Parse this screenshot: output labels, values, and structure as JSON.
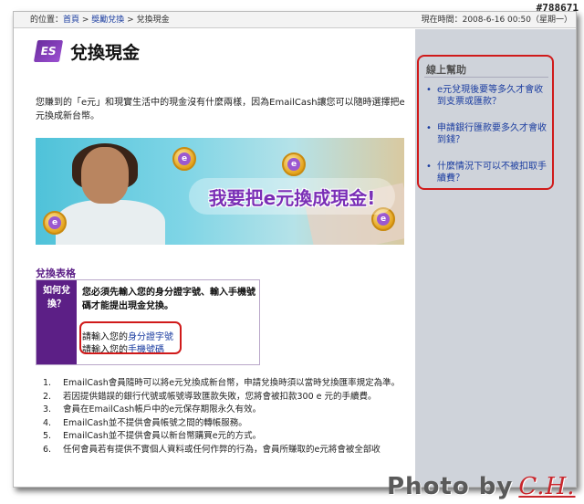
{
  "watermark": {
    "id_tag": "#788671"
  },
  "topbar": {
    "location_prefix": "的位置：",
    "crumb_home": "首頁",
    "crumb_sep1": " > ",
    "crumb_rewards": "獎勵兌換",
    "crumb_sep2": " > ",
    "crumb_current": "兌換現金",
    "datetime": "現在時間：2008-6-16 00:50（星期一）"
  },
  "page": {
    "logo_text": "ES",
    "title": "兌換現金",
    "intro": "您賺到的「e元」和現實生活中的現金沒有什麼兩樣，因為EmailCash讓您可以隨時選擇把e元換成新台幣。"
  },
  "banner": {
    "slogan": "我要把e元換成現金!",
    "coin_label": "e"
  },
  "form": {
    "title": "兌換表格",
    "how_label": "如何兌換？",
    "instruction": "您必須先輸入您的身分證字號、輸入手機號碼才能提出現金兌換。",
    "id_prefix": "請輸入您的",
    "id_link": "身分證字號",
    "phone_prefix": "請輸入您的",
    "phone_link": "手機號碼"
  },
  "notes": [
    {
      "num": "1.",
      "text": "EmailCash會員隨時可以將e元兌換成新台幣，申請兌換時須以當時兌換匯率規定為準。"
    },
    {
      "num": "2.",
      "text": "若因提供錯誤的銀行代號或帳號導致匯款失敗，您將會被扣款300 e 元的手續費。"
    },
    {
      "num": "3.",
      "text": "會員在EmailCash帳戶中的e元保存期限永久有效。"
    },
    {
      "num": "4.",
      "text": "EmailCash並不提供會員帳號之間的轉帳服務。"
    },
    {
      "num": "5.",
      "text": "EmailCash並不提供會員以新台幣購買e元的方式。"
    },
    {
      "num": "6.",
      "text": "任何會員若有提供不實個人資料或任何作弊的行為，會員所賺取的e元將會被全部收"
    }
  ],
  "sidebar": {
    "heading": "線上幫助",
    "links": [
      {
        "bullet": "•",
        "label": "e元兌現後要等多久才會收到支票或匯款？"
      },
      {
        "bullet": "•",
        "label": "申請銀行匯款要多久才會收到錢？"
      },
      {
        "bullet": "•",
        "label": "什麼情況下可以不被扣取手續費？"
      }
    ]
  },
  "photo_credit": {
    "text": "Photo by",
    "signature": "C.H."
  },
  "colors": {
    "brand_purple": "#5c1f86",
    "link_blue": "#1a3ca0",
    "highlight_red": "#d01a1a",
    "sidebar_bg": "#cfd3da"
  }
}
